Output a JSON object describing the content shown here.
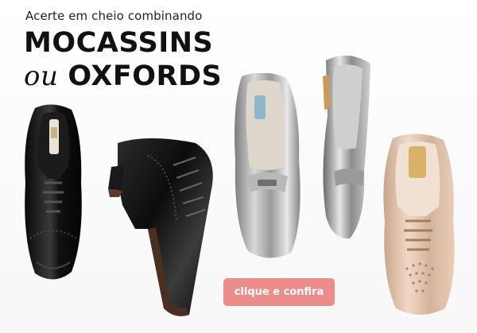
{
  "banner": {
    "tagline": "Acerte em cheio combinando",
    "headline_line1": "MOCASSINS",
    "headline_conjunction": "ou",
    "headline_line2": "OXFORDS",
    "cta_label": "clique e confira"
  },
  "colors": {
    "cta_background": "#ec8d8b",
    "cta_text": "#ffffff",
    "headline": "#111111"
  },
  "products": [
    {
      "name": "black-patent-oxford-flat",
      "icon": "oxford-shoe"
    },
    {
      "name": "black-patent-heeled-oxford",
      "icon": "heeled-oxford-shoe"
    },
    {
      "name": "silver-metallic-loafer",
      "icon": "loafer-shoe"
    },
    {
      "name": "silver-metallic-slim-loafer",
      "icon": "loafer-shoe"
    },
    {
      "name": "nude-patent-oxford",
      "icon": "oxford-shoe"
    }
  ]
}
